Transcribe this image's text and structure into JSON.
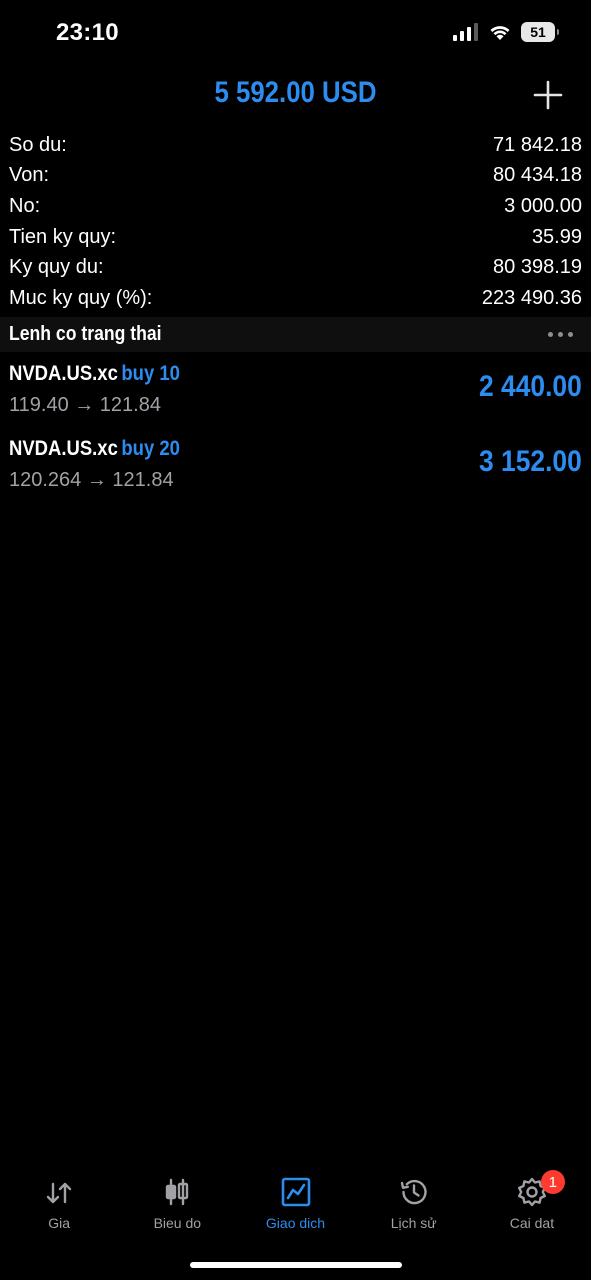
{
  "status_bar": {
    "time": "23:10",
    "battery": "51"
  },
  "header": {
    "title": "5 592.00 USD"
  },
  "summary": [
    {
      "label": "So du:",
      "value": "71 842.18"
    },
    {
      "label": "Von:",
      "value": "80 434.18"
    },
    {
      "label": "No:",
      "value": "3 000.00"
    },
    {
      "label": "Tien ky quy:",
      "value": "35.99"
    },
    {
      "label": "Ky quy du:",
      "value": "80 398.19"
    },
    {
      "label": "Muc ky quy (%):",
      "value": "223 490.36"
    }
  ],
  "positions_section": {
    "title": "Lenh co trang thai"
  },
  "positions": [
    {
      "symbol": "NVDA.US.xc",
      "type": "buy 10",
      "prices": "119.40 → 121.84",
      "profit": "2 440.00"
    },
    {
      "symbol": "NVDA.US.xc",
      "type": "buy 20",
      "prices": "120.264 → 121.84",
      "profit": "3 152.00"
    }
  ],
  "tab_bar": {
    "tabs": [
      {
        "label": "Gia",
        "icon": "arrows-updown-icon"
      },
      {
        "label": "Bieu do",
        "icon": "candlestick-icon"
      },
      {
        "label": "Giao dich",
        "icon": "trade-chart-icon",
        "active": true
      },
      {
        "label": "Lịch sử",
        "icon": "history-icon"
      },
      {
        "label": "Cai dat",
        "icon": "gear-icon",
        "badge": "1"
      }
    ]
  },
  "colors": {
    "accent": "#2d8cf0",
    "background": "#000000",
    "secondary_text": "#a1a1a6",
    "badge": "#ff3b30"
  }
}
